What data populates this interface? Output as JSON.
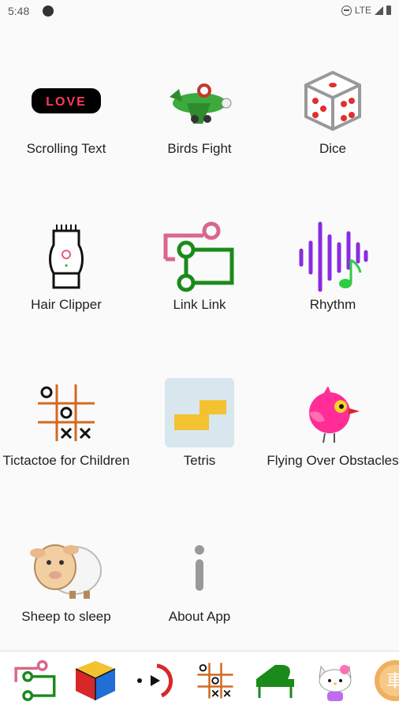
{
  "status": {
    "time": "5:48",
    "network": "LTE"
  },
  "apps": [
    {
      "label": "Scrolling Text",
      "icon": "love-led-sign-icon"
    },
    {
      "label": "Birds Fight",
      "icon": "green-plane-icon"
    },
    {
      "label": "Dice",
      "icon": "dice-icon"
    },
    {
      "label": "Hair Clipper",
      "icon": "hair-clipper-icon"
    },
    {
      "label": "Link Link",
      "icon": "link-circuit-icon"
    },
    {
      "label": "Rhythm",
      "icon": "sound-wave-icon"
    },
    {
      "label": "Tictactoe for Children",
      "icon": "tictactoe-icon"
    },
    {
      "label": "Tetris",
      "icon": "tetris-block-icon"
    },
    {
      "label": "Flying Over Obstacles",
      "icon": "pink-bird-icon"
    },
    {
      "label": "Sheep to sleep",
      "icon": "sheep-icon"
    },
    {
      "label": "About App",
      "icon": "info-icon"
    }
  ],
  "dock": {
    "items": [
      "link-circuit-icon",
      "rubiks-cube-icon",
      "dial-icon",
      "tictactoe-icon",
      "piano-icon",
      "kitty-icon",
      "car-character-icon"
    ]
  },
  "led_text": "LOVE",
  "colors": {
    "led_text": "#ff3b5c",
    "pink": "#d9678a",
    "green": "#1a9a1a",
    "purple": "#8a2be2",
    "orange": "#d2691e",
    "yellow": "#f2c230",
    "tetris_bg": "#d8e6ee"
  }
}
